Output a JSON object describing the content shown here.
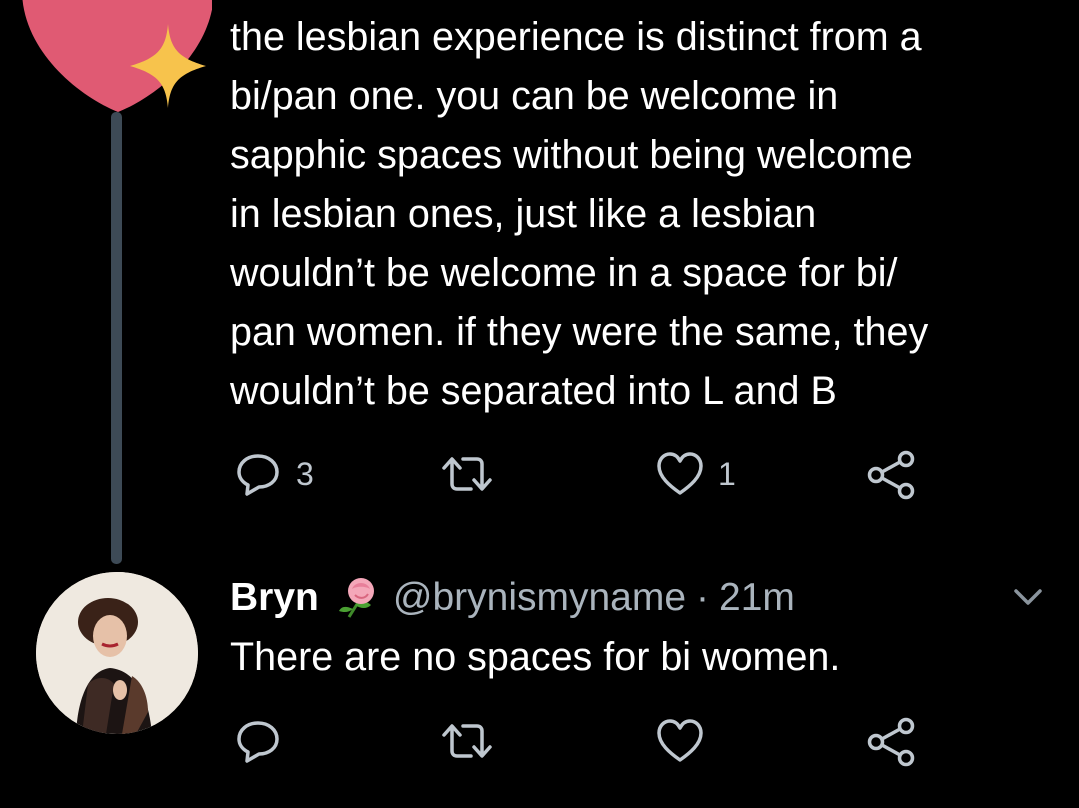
{
  "tweet": {
    "text": "the lesbian experience is distinct from a\nbi/pan one. you can be welcome in\nsapphic spaces without being welcome\nin lesbian ones, just like a lesbian\nwouldn’t be welcome in a space for bi/\npan women. if they were the same, they\nwouldn’t be separated into L and B",
    "reply_count": "3",
    "retweet_count": "",
    "like_count": "1"
  },
  "reply": {
    "name": "Bryn",
    "name_emoji": "rose-emoji",
    "handle": "@brynismyname",
    "separator": "·",
    "time": "21m",
    "text": "There are no spaces for bi women.",
    "reply_count": "",
    "retweet_count": "",
    "like_count": ""
  },
  "icons": {
    "reply": "reply-icon",
    "retweet": "retweet-icon",
    "like": "heart-icon",
    "share": "share-icon",
    "menu": "chevron-down-icon"
  },
  "colors": {
    "background": "#000000",
    "text": "#ffffff",
    "secondary_text": "#aab4bd",
    "thread_line": "#3d4a56",
    "icon": "#bfc7cf"
  }
}
